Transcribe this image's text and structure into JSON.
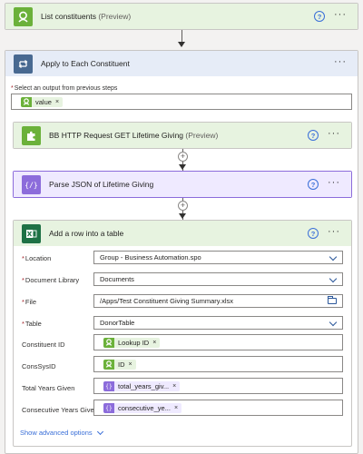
{
  "list_constituents": {
    "title": "List constituents",
    "preview": "(Preview)",
    "help": "?",
    "more": "···"
  },
  "apply_each": {
    "title": "Apply to Each Constituent",
    "more": "···",
    "select_label": "Select an output from previous steps",
    "token": "value"
  },
  "bb_http": {
    "title": "BB HTTP Request GET Lifetime Giving",
    "preview": "(Preview)",
    "help": "?",
    "more": "···"
  },
  "parse_json": {
    "title": "Parse JSON of Lifetime Giving",
    "help": "?",
    "more": "···"
  },
  "add_row": {
    "title": "Add a row into a table",
    "help": "?",
    "more": "···",
    "fields": {
      "location": {
        "label": "Location",
        "value": "Group - Business Automation.spo"
      },
      "document_library": {
        "label": "Document Library",
        "value": "Documents"
      },
      "file": {
        "label": "File",
        "value": "/Apps/Test Constituent Giving Summary.xlsx"
      },
      "table": {
        "label": "Table",
        "value": "DonorTable"
      },
      "constituent_id": {
        "label": "Constituent ID",
        "token": "Lookup ID"
      },
      "conssysid": {
        "label": "ConsSysID",
        "token": "ID"
      },
      "total_years": {
        "label": "Total Years Given",
        "token": "total_years_giv..."
      },
      "consecutive_years": {
        "label": "Consecutive Years Given",
        "token": "consecutive_ye..."
      }
    },
    "show_advanced": "Show advanced options"
  },
  "required_mark": "*",
  "token_remove": "×",
  "plus": "+",
  "colors": {
    "accent_blue": "#3a6fd8",
    "green_header": "#e7f3e0",
    "blue_header": "#e6ecf7",
    "purple_header": "#efeaff",
    "excel_green": "#1e7145"
  }
}
